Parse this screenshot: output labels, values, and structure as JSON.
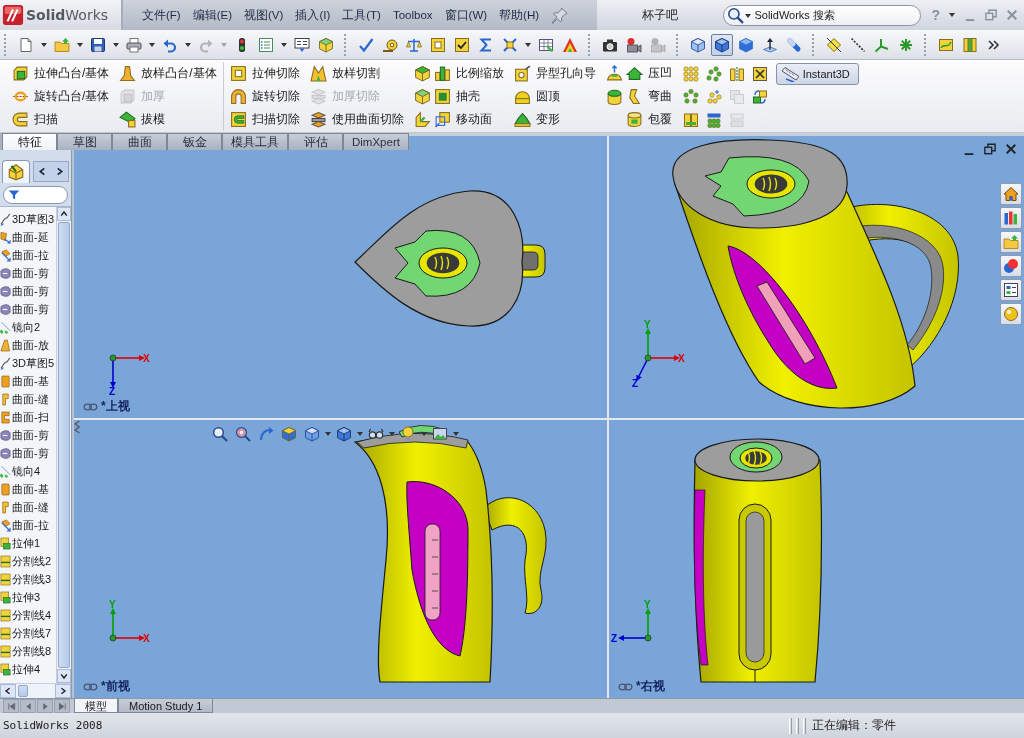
{
  "window": {
    "logo": "**Solid**Works",
    "menu": [
      "文件(F)",
      "编辑(E)",
      "视图(V)",
      "插入(I)",
      "工具(T)",
      "Toolbox",
      "窗口(W)",
      "帮助(H)"
    ],
    "title": "杯子吧",
    "search": {
      "placeholder": "SolidWorks 搜索"
    },
    "help": "?"
  },
  "toolbar": [
    {
      "items": [
        {
          "kind": "new",
          "dropdown": true,
          "disabled": false
        },
        {
          "kind": "open",
          "dropdown": true,
          "disabled": false
        },
        {
          "kind": "save",
          "dropdown": true,
          "disabled": false
        },
        {
          "kind": "print",
          "dropdown": true,
          "disabled": false
        },
        {
          "kind": "undo",
          "dropdown": true,
          "disabled": false
        },
        {
          "kind": "redo",
          "dropdown": true,
          "disabled": true
        },
        {
          "kind": "rebuild",
          "dropdown": false,
          "disabled": false
        },
        {
          "kind": "options",
          "dropdown": true,
          "disabled": false
        },
        {
          "kind": "file-props",
          "dropdown": false,
          "disabled": false
        },
        {
          "kind": "addins",
          "dropdown": false,
          "disabled": false
        }
      ]
    },
    {
      "items": [
        {
          "kind": "spell",
          "dropdown": false,
          "disabled": false
        },
        {
          "kind": "measure",
          "dropdown": false,
          "disabled": false
        },
        {
          "kind": "mass",
          "dropdown": false,
          "disabled": false
        },
        {
          "kind": "section-props",
          "dropdown": false,
          "disabled": false
        },
        {
          "kind": "check",
          "dropdown": false,
          "disabled": false
        },
        {
          "kind": "sigma",
          "dropdown": false,
          "disabled": false
        },
        {
          "kind": "interference",
          "dropdown": true,
          "disabled": false
        },
        {
          "kind": "table",
          "dropdown": false,
          "disabled": false
        },
        {
          "kind": "curvature",
          "dropdown": false,
          "disabled": false
        }
      ]
    },
    {
      "items": [
        {
          "kind": "camera",
          "dropdown": false,
          "disabled": false
        },
        {
          "kind": "record",
          "dropdown": false,
          "disabled": false
        },
        {
          "kind": "playback",
          "dropdown": false,
          "disabled": true
        }
      ]
    },
    {
      "items": [
        {
          "kind": "hidden-lines",
          "dropdown": false,
          "disabled": false,
          "selected": false
        },
        {
          "kind": "shaded-edges",
          "dropdown": false,
          "disabled": false,
          "selected": true
        },
        {
          "kind": "shaded",
          "dropdown": false,
          "disabled": false,
          "selected": false
        },
        {
          "kind": "normal-to",
          "dropdown": false,
          "disabled": false,
          "selected": false
        },
        {
          "kind": "probe",
          "dropdown": false,
          "disabled": false,
          "selected": false
        }
      ]
    },
    {
      "items": [
        {
          "kind": "plane",
          "dropdown": false,
          "disabled": false
        },
        {
          "kind": "axis",
          "dropdown": false,
          "disabled": false
        },
        {
          "kind": "coord",
          "dropdown": false,
          "disabled": false
        },
        {
          "kind": "point",
          "dropdown": false,
          "disabled": false
        }
      ]
    },
    {
      "items": [
        {
          "kind": "sketch",
          "dropdown": false,
          "disabled": false
        },
        {
          "kind": "column",
          "dropdown": false,
          "disabled": false
        },
        {
          "kind": "more",
          "dropdown": false,
          "disabled": false
        }
      ]
    }
  ],
  "command_groups": [
    {
      "columns": [
        {
          "kind": "labeled",
          "items": [
            {
              "label": "拉伸凸台/基体",
              "disabled": false,
              "icons": [
                {
                  "kind": "extrude-boss"
                }
              ]
            },
            {
              "label": "旋转凸台/基体",
              "disabled": false,
              "icons": [
                {
                  "kind": "revolve-boss"
                }
              ]
            },
            {
              "label": "扫描",
              "disabled": false,
              "icons": [
                {
                  "kind": "sweep"
                }
              ]
            }
          ]
        },
        {
          "kind": "labeled",
          "items": [
            {
              "label": "放样凸台/基体",
              "disabled": false,
              "icons": [
                {
                  "kind": "loft"
                }
              ]
            },
            {
              "label": "加厚",
              "disabled": true,
              "icons": [
                {
                  "kind": "thicken"
                }
              ]
            },
            {
              "label": "拔模",
              "disabled": false,
              "icons": [
                {
                  "kind": "draft"
                }
              ]
            }
          ]
        }
      ]
    },
    {
      "columns": [
        {
          "kind": "labeled",
          "items": [
            {
              "label": "拉伸切除",
              "disabled": false,
              "icons": [
                {
                  "kind": "cut-extrude"
                }
              ]
            },
            {
              "label": "旋转切除",
              "disabled": false,
              "icons": [
                {
                  "kind": "cut-revolve"
                }
              ]
            },
            {
              "label": "扫描切除",
              "disabled": false,
              "icons": [
                {
                  "kind": "cut-sweep"
                }
              ]
            }
          ]
        },
        {
          "kind": "labeled",
          "items": [
            {
              "label": "放样切割",
              "disabled": false,
              "icons": [
                {
                  "kind": "loft-cut"
                }
              ]
            },
            {
              "label": "加厚切除",
              "disabled": true,
              "icons": [
                {
                  "kind": "thicken-cut"
                }
              ]
            },
            {
              "label": "使用曲面切除",
              "disabled": false,
              "icons": [
                {
                  "kind": "surface-cut"
                }
              ]
            }
          ]
        },
        {
          "kind": "labeled",
          "items": [
            {
              "label": "比例缩放",
              "disabled": false,
              "icons": [
                {
                  "kind": "fillet"
                },
                {
                  "kind": "scale"
                }
              ]
            },
            {
              "label": "抽壳",
              "disabled": false,
              "icons": [
                {
                  "kind": "chamfer"
                },
                {
                  "kind": "shell"
                }
              ]
            },
            {
              "label": "移动面",
              "disabled": false,
              "icons": [
                {
                  "kind": "rib"
                },
                {
                  "kind": "move-face"
                }
              ]
            }
          ]
        },
        {
          "kind": "labeled",
          "items": [
            {
              "label": "异型孔向导",
              "disabled": false,
              "icons": [
                {
                  "kind": "hole"
                }
              ]
            },
            {
              "label": "圆顶",
              "disabled": false,
              "icons": [
                {
                  "kind": "dome"
                }
              ]
            },
            {
              "label": "变形",
              "disabled": false,
              "icons": [
                {
                  "kind": "deform"
                }
              ]
            }
          ]
        },
        {
          "kind": "labeled",
          "items": [
            {
              "label": "压凹",
              "disabled": false,
              "icons": [
                {
                  "kind": "freeform"
                },
                {
                  "kind": "indent"
                }
              ]
            },
            {
              "label": "弯曲",
              "disabled": false,
              "icons": [
                {
                  "kind": "cylinder-cap"
                },
                {
                  "kind": "flex"
                }
              ]
            },
            {
              "label": "包覆",
              "disabled": false,
              "icons": [
                {
                  "kind": "wrap"
                }
              ]
            }
          ]
        },
        {
          "kind": "icon-grid",
          "rows": [
            [
              {
                "kind": "linear-pattern",
                "disabled": false
              },
              {
                "kind": "curve-pattern",
                "disabled": false
              },
              {
                "kind": "mirror",
                "disabled": false
              },
              {
                "kind": "intersect",
                "disabled": false
              }
            ],
            [
              {
                "kind": "circular-pattern",
                "disabled": false
              },
              {
                "kind": "fill-pattern",
                "disabled": false
              },
              {
                "kind": "combine",
                "disabled": true
              },
              {
                "kind": "move-copy",
                "disabled": false
              }
            ],
            [
              {
                "kind": "table-pattern",
                "disabled": false
              },
              {
                "kind": "sketch-pattern",
                "disabled": false
              },
              {
                "kind": "split",
                "disabled": true
              }
            ]
          ]
        }
      ]
    }
  ],
  "instant3d": {
    "label": "Instant3D",
    "selected": true
  },
  "tabs": [
    {
      "label": "特征",
      "selected": true
    },
    {
      "label": "草图",
      "selected": false
    },
    {
      "label": "曲面",
      "selected": false
    },
    {
      "label": "钣金",
      "selected": false
    },
    {
      "label": "模具工具",
      "selected": false
    },
    {
      "label": "评估",
      "selected": false
    },
    {
      "label": "DimXpert",
      "selected": false
    }
  ],
  "feature_tree": {
    "manager_tab": {
      "selected": true
    },
    "items": [
      {
        "label": "3D草图3",
        "kind": "sketch3d"
      },
      {
        "label": "曲面-延",
        "kind": "surface-extend"
      },
      {
        "label": "曲面-拉",
        "kind": "surface-extrude"
      },
      {
        "label": "曲面-剪",
        "kind": "surface-trim"
      },
      {
        "label": "曲面-剪",
        "kind": "surface-trim"
      },
      {
        "label": "曲面-剪",
        "kind": "surface-trim"
      },
      {
        "label": "镜向2",
        "kind": "mirror"
      },
      {
        "label": "曲面-放",
        "kind": "surface-loft"
      },
      {
        "label": "3D草图5",
        "kind": "sketch3d"
      },
      {
        "label": "曲面-基",
        "kind": "surface-base"
      },
      {
        "label": "曲面-缝",
        "kind": "surface-knit"
      },
      {
        "label": "曲面-扫",
        "kind": "surface-sweep"
      },
      {
        "label": "曲面-剪",
        "kind": "surface-trim"
      },
      {
        "label": "曲面-剪",
        "kind": "surface-trim"
      },
      {
        "label": "镜向4",
        "kind": "mirror"
      },
      {
        "label": "曲面-基",
        "kind": "surface-base"
      },
      {
        "label": "曲面-缝",
        "kind": "surface-knit"
      },
      {
        "label": "曲面-拉",
        "kind": "surface-extrude"
      },
      {
        "label": "拉伸1",
        "kind": "extrude"
      },
      {
        "label": "分割线2",
        "kind": "split-line"
      },
      {
        "label": "分割线3",
        "kind": "split-line"
      },
      {
        "label": "拉伸3",
        "kind": "extrude"
      },
      {
        "label": "分割线4",
        "kind": "split-line"
      },
      {
        "label": "分割线7",
        "kind": "split-line"
      },
      {
        "label": "分割线8",
        "kind": "split-line"
      },
      {
        "label": "拉伸4",
        "kind": "extrude"
      }
    ]
  },
  "viewports": [
    {
      "kind": "top",
      "label": "*上视",
      "active": false,
      "axes": [
        {
          "label": "X",
          "kind": "right",
          "color": "#e00000"
        },
        {
          "label": "Z",
          "kind": "down",
          "color": "#0000d0"
        }
      ]
    },
    {
      "kind": "isometric",
      "active": true,
      "axes": [
        {
          "label": "Y",
          "kind": "up",
          "color": "#00a000"
        },
        {
          "label": "X",
          "kind": "right",
          "color": "#e00000"
        },
        {
          "label": "Z",
          "kind": "down-left",
          "color": "#0000d0"
        }
      ]
    },
    {
      "kind": "front",
      "label": "*前视",
      "active": false,
      "view_toolbar": [
        {
          "kind": "zoom-fit",
          "dropdown": false
        },
        {
          "kind": "zoom-area",
          "dropdown": false
        },
        {
          "kind": "previous-view",
          "dropdown": false
        },
        {
          "kind": "section-view",
          "dropdown": false
        },
        {
          "kind": "orientation",
          "dropdown": true
        },
        {
          "kind": "display-style",
          "dropdown": true
        },
        {
          "kind": "hide-show",
          "dropdown": true
        },
        {
          "kind": "edit-appearance",
          "dropdown": true
        },
        {
          "kind": "scene",
          "dropdown": true
        }
      ],
      "axes": [
        {
          "label": "Y",
          "kind": "up",
          "color": "#00a000"
        },
        {
          "label": "X",
          "kind": "right",
          "color": "#e00000"
        }
      ]
    },
    {
      "kind": "right",
      "label": "*右视",
      "active": false,
      "axes": [
        {
          "label": "Y",
          "kind": "up",
          "color": "#00a000"
        },
        {
          "label": "Z",
          "kind": "left",
          "color": "#0000d0"
        }
      ]
    }
  ],
  "task_pane": [
    {
      "kind": "home"
    },
    {
      "kind": "library"
    },
    {
      "kind": "file-explorer"
    },
    {
      "kind": "appearances"
    },
    {
      "kind": "view-palette"
    },
    {
      "kind": "custom-properties"
    }
  ],
  "bottom_tabs": [
    {
      "label": "模型",
      "selected": true
    },
    {
      "label": "Motion Study 1",
      "selected": false
    }
  ],
  "status_bar": {
    "app": "SolidWorks 2008",
    "mode": "正在编辑：零件"
  }
}
